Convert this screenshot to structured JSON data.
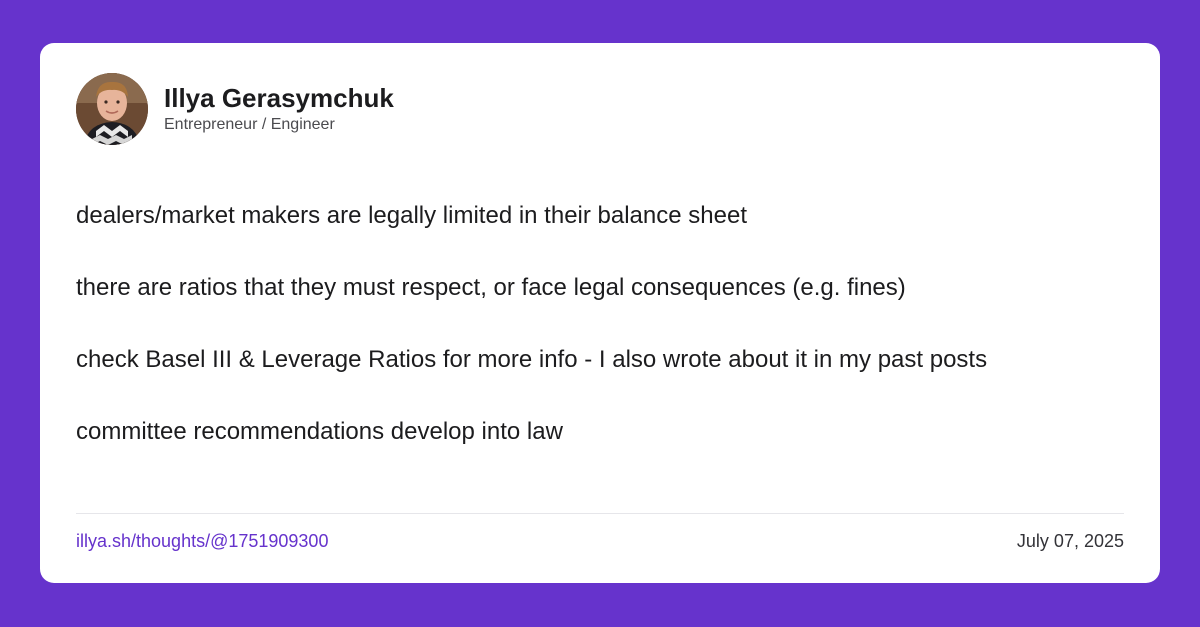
{
  "colors": {
    "background": "#6633cc",
    "card": "#ffffff",
    "text": "#1c1c1e",
    "link": "#6633cc"
  },
  "author": {
    "name": "Illya Gerasymchuk",
    "role": "Entrepreneur / Engineer",
    "avatar_icon": "avatar-photo"
  },
  "post": {
    "paragraphs": [
      "dealers/market makers are legally limited in their balance sheet",
      "there are ratios that they must respect, or face legal consequences (e.g. fines)",
      "check Basel III & Leverage Ratios for more info - I also wrote about it in my past posts",
      "committee recommendations develop into law"
    ]
  },
  "footer": {
    "link": "illya.sh/thoughts/@1751909300",
    "date": "July 07, 2025"
  }
}
